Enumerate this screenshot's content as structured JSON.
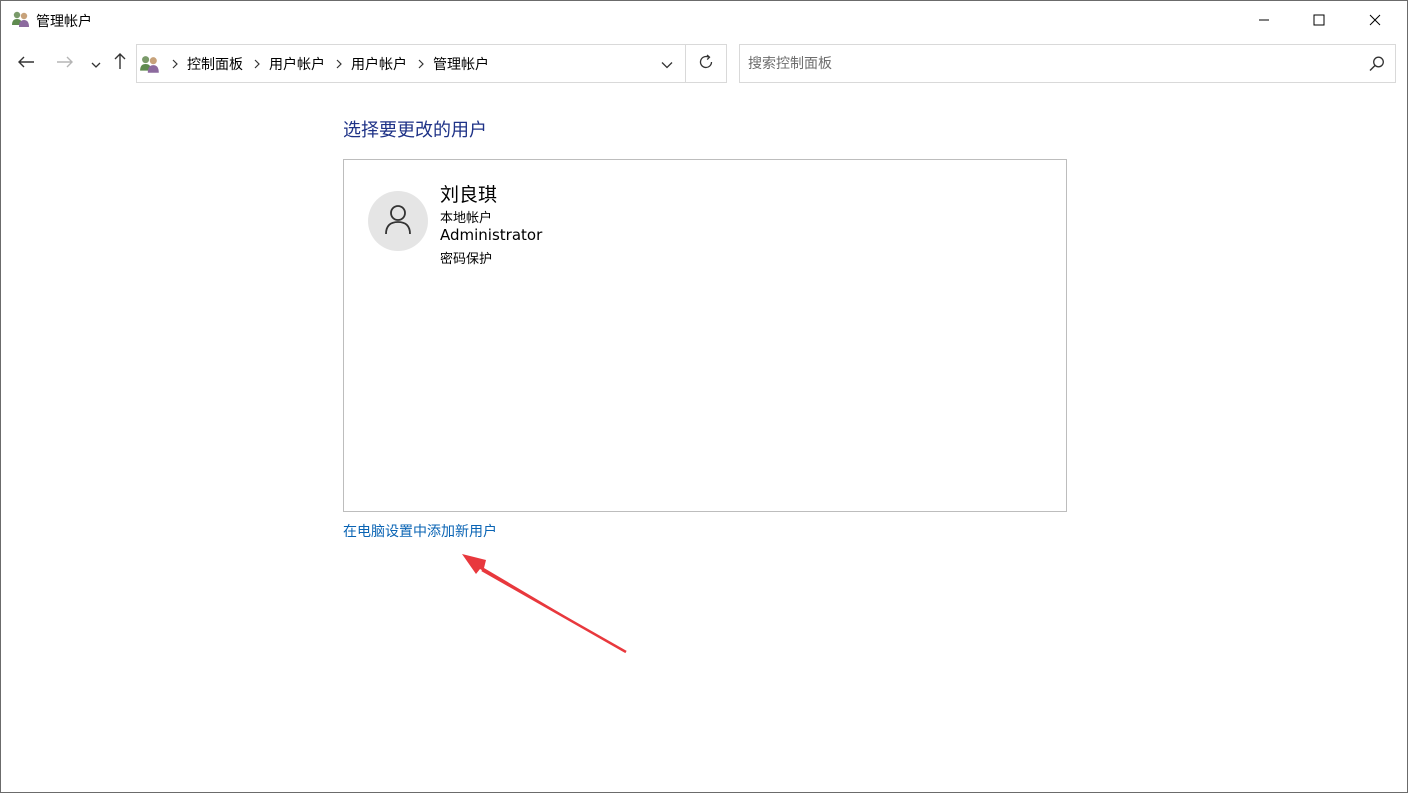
{
  "window": {
    "title": "管理帐户",
    "controls": {
      "minimize": "minimize-icon",
      "maximize": "maximize-icon",
      "close": "close-icon"
    }
  },
  "navigation": {
    "back": "back-arrow-icon",
    "forward": "forward-arrow-icon",
    "recent": "chevron-down-icon",
    "up": "up-arrow-icon"
  },
  "address_bar": {
    "breadcrumbs": [
      "控制面板",
      "用户帐户",
      "用户帐户",
      "管理帐户"
    ]
  },
  "search": {
    "placeholder": "搜索控制面板",
    "value": ""
  },
  "content": {
    "heading": "选择要更改的用户",
    "users": [
      {
        "name": "刘良琪",
        "account_type": "本地帐户",
        "role": "Administrator",
        "password_status": "密码保护"
      }
    ],
    "add_user_link": "在电脑设置中添加新用户"
  },
  "colors": {
    "heading": "#1e3287",
    "link": "#0a64b4",
    "annotation_arrow": "#e8383d",
    "avatar_bg": "#e5e5e5"
  }
}
